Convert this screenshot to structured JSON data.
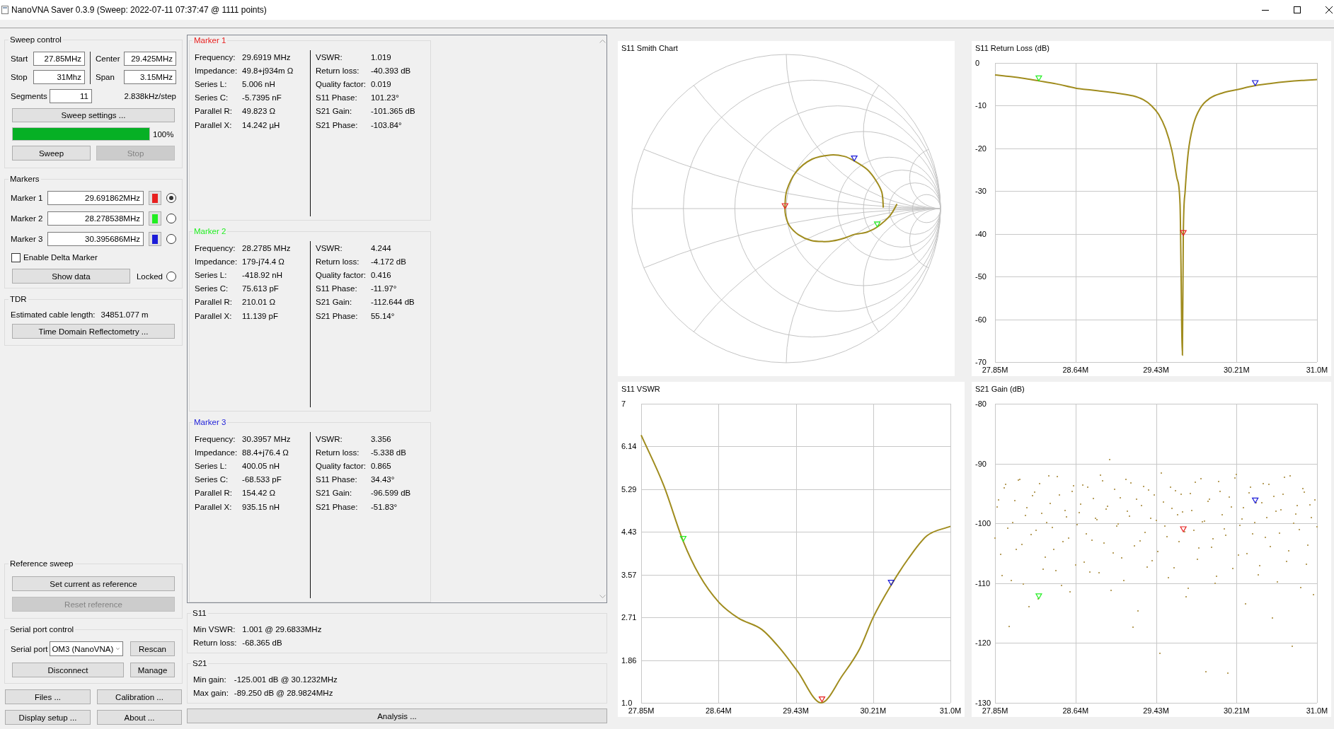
{
  "window": {
    "title": "NanoVNA Saver 0.3.9 (Sweep: 2022-07-11 07:37:47 @ 1111 points)"
  },
  "sweep_control": {
    "title": "Sweep control",
    "fields": [
      {
        "label": "Start",
        "value": "27.85MHz"
      },
      {
        "label": "Center",
        "value": "29.425MHz"
      },
      {
        "label": "Stop",
        "value": "31Mhz"
      },
      {
        "label": "Span",
        "value": "3.15MHz"
      }
    ],
    "segments": {
      "label": "Segments",
      "value": "11"
    },
    "step": "2.838kHz/step",
    "settings_button": "Sweep settings ...",
    "progress": {
      "level": 1,
      "text": "100%"
    },
    "buttons": [
      {
        "label": "Sweep",
        "disabled": false
      },
      {
        "label": "Stop",
        "disabled": true
      }
    ]
  },
  "markers": {
    "title": "Markers",
    "items": [
      {
        "label": "Marker 1",
        "value": "29.691862MHz",
        "color": "#e8201f",
        "selected": true
      },
      {
        "label": "Marker 2",
        "value": "28.278538MHz",
        "color": "#22ee22",
        "selected": false
      },
      {
        "label": "Marker 3",
        "value": "30.395686MHz",
        "color": "#1c1cd8",
        "selected": false
      }
    ],
    "delta_marker": {
      "label": "Enable Delta Marker",
      "checked": false
    },
    "show_data_button": "Show data",
    "locked": {
      "label": "Locked",
      "checked": false
    }
  },
  "tdr": {
    "title": "TDR",
    "label": "Estimated cable length:",
    "value": "34851.077 m",
    "button": "Time Domain Reflectometry ..."
  },
  "reference_sweep": {
    "title": "Reference sweep",
    "buttons": [
      {
        "label": "Set current as reference",
        "disabled": false
      },
      {
        "label": "Reset reference",
        "disabled": true
      }
    ]
  },
  "serial_port": {
    "title": "Serial port control",
    "label": "Serial port",
    "port": "OM3 (NanoVNA)",
    "rescan_button": "Rescan",
    "disconnect_button": "Disconnect",
    "manage_button": "Manage"
  },
  "bottom_buttons": [
    "Files ...",
    "Calibration ...",
    "Display setup ...",
    "About ..."
  ],
  "marker_data": [
    {
      "title": "Marker 1",
      "left": [
        {
          "label": "Frequency:",
          "value": "29.6919 MHz"
        },
        {
          "label": "Impedance:",
          "value": "49.8+j934m Ω"
        },
        {
          "label": "Series L:",
          "value": "5.006 nH"
        },
        {
          "label": "Series C:",
          "value": "-5.7395 nF"
        },
        {
          "label": "Parallel R:",
          "value": "49.823 Ω"
        },
        {
          "label": "Parallel X:",
          "value": "14.242 µH"
        }
      ],
      "right": [
        {
          "label": "VSWR:",
          "value": "1.019"
        },
        {
          "label": "Return loss:",
          "value": "-40.393 dB"
        },
        {
          "label": "Quality factor:",
          "value": "0.019"
        },
        {
          "label": "S11 Phase:",
          "value": "101.23°"
        },
        {
          "label": "S21 Gain:",
          "value": "-101.365 dB"
        },
        {
          "label": "S21 Phase:",
          "value": "-103.84°"
        }
      ]
    },
    {
      "title": "Marker 2",
      "left": [
        {
          "label": "Frequency:",
          "value": "28.2785 MHz"
        },
        {
          "label": "Impedance:",
          "value": "179-j74.4 Ω"
        },
        {
          "label": "Series L:",
          "value": "-418.92 nH"
        },
        {
          "label": "Series C:",
          "value": "75.613 pF"
        },
        {
          "label": "Parallel R:",
          "value": "210.01 Ω"
        },
        {
          "label": "Parallel X:",
          "value": "11.139 pF"
        }
      ],
      "right": [
        {
          "label": "VSWR:",
          "value": "4.244"
        },
        {
          "label": "Return loss:",
          "value": "-4.172 dB"
        },
        {
          "label": "Quality factor:",
          "value": "0.416"
        },
        {
          "label": "S11 Phase:",
          "value": "-11.97°"
        },
        {
          "label": "S21 Gain:",
          "value": "-112.644 dB"
        },
        {
          "label": "S21 Phase:",
          "value": "55.14°"
        }
      ]
    },
    {
      "title": "Marker 3",
      "left": [
        {
          "label": "Frequency:",
          "value": "30.3957 MHz"
        },
        {
          "label": "Impedance:",
          "value": "88.4+j76.4 Ω"
        },
        {
          "label": "Series L:",
          "value": "400.05 nH"
        },
        {
          "label": "Series C:",
          "value": "-68.533 pF"
        },
        {
          "label": "Parallel R:",
          "value": "154.42 Ω"
        },
        {
          "label": "Parallel X:",
          "value": "935.15 nH"
        }
      ],
      "right": [
        {
          "label": "VSWR:",
          "value": "3.356"
        },
        {
          "label": "Return loss:",
          "value": "-5.338 dB"
        },
        {
          "label": "Quality factor:",
          "value": "0.865"
        },
        {
          "label": "S11 Phase:",
          "value": "34.43°"
        },
        {
          "label": "S21 Gain:",
          "value": "-96.599 dB"
        },
        {
          "label": "S21 Phase:",
          "value": "-51.83°"
        }
      ]
    }
  ],
  "s11_summary": {
    "title": "S11",
    "rows": [
      {
        "label": "Min VSWR:",
        "value": "1.001 @ 29.6833MHz"
      },
      {
        "label": "Return loss:",
        "value": "-68.365 dB"
      }
    ]
  },
  "s21_summary": {
    "title": "S21",
    "rows": [
      {
        "label": "Min gain:",
        "value": "-125.001 dB @ 30.1232MHz"
      },
      {
        "label": "Max gain:",
        "value": "-89.250 dB @ 28.9824MHz"
      }
    ]
  },
  "analysis_button": "Analysis ...",
  "charts": [
    {
      "kind": "smith",
      "title": "S11 Smith Chart"
    },
    {
      "kind": "xy",
      "chart_data": {
        "type": "line",
        "title": "S11 Return Loss (dB)",
        "x": [
          27.85,
          28.0,
          28.15,
          28.2785,
          28.45,
          28.64,
          28.85,
          29.05,
          29.2,
          29.3,
          29.38,
          29.45,
          29.52,
          29.58,
          29.63,
          29.66,
          29.6833,
          29.6919,
          29.71,
          29.74,
          29.79,
          29.86,
          29.95,
          30.08,
          30.21,
          30.3957,
          30.55,
          30.7,
          30.85,
          31.0
        ],
        "series": [
          {
            "color": "#a08c1e",
            "values": [
              -2.8,
              -3.2,
              -3.7,
              -4.2,
              -4.9,
              -5.9,
              -6.5,
              -7.1,
              -7.7,
              -8.6,
              -10.0,
              -12.0,
              -15.5,
              -20.5,
              -27.0,
              -33.0,
              -68.4,
              -40.4,
              -30.0,
              -21.0,
              -14.5,
              -10.5,
              -8.3,
              -7.0,
              -6.3,
              -5.3,
              -4.8,
              -4.4,
              -4.1,
              -3.9
            ]
          }
        ],
        "xlim": [
          27.85,
          31.0
        ],
        "ylim": [
          -70,
          0
        ],
        "xticks": [
          {
            "value": 27.85,
            "label": "27.85M"
          },
          {
            "value": 28.6375,
            "label": "28.64M"
          },
          {
            "value": 29.425,
            "label": "29.43M"
          },
          {
            "value": 30.2125,
            "label": "30.21M"
          },
          {
            "value": 31.0,
            "label": "31.0M"
          }
        ],
        "yticks": [
          0,
          -10,
          -20,
          -30,
          -40,
          -50,
          -60,
          -70
        ],
        "grid": true
      }
    },
    {
      "kind": "xy",
      "chart_data": {
        "type": "line",
        "title": "S11 VSWR",
        "x": [
          27.85,
          28.08,
          28.2785,
          28.44,
          28.64,
          28.84,
          29.08,
          29.26,
          29.44,
          29.6833,
          29.9,
          30.08,
          30.21,
          30.3957,
          30.57,
          30.76,
          31.0
        ],
        "series": [
          {
            "color": "#a08c1e",
            "values": [
              6.37,
              5.36,
              4.24,
              3.57,
              3.02,
              2.7,
              2.47,
              2.1,
              1.64,
              1.0,
              1.55,
              2.1,
              2.7,
              3.36,
              3.89,
              4.35,
              4.54
            ]
          }
        ],
        "xlim": [
          27.85,
          31.0
        ],
        "ylim": [
          1,
          7
        ],
        "xticks": [
          {
            "value": 27.85,
            "label": "27.85M"
          },
          {
            "value": 28.6375,
            "label": "28.64M"
          },
          {
            "value": 29.425,
            "label": "29.43M"
          },
          {
            "value": 30.2125,
            "label": "30.21M"
          },
          {
            "value": 31.0,
            "label": "31.0M"
          }
        ],
        "yticks": [
          7,
          {
            "value": 6.143,
            "label": "6.14"
          },
          {
            "value": 5.286,
            "label": "5.29"
          },
          {
            "value": 4.429,
            "label": "4.43"
          },
          {
            "value": 3.571,
            "label": "3.57"
          },
          {
            "value": 2.714,
            "label": "2.71"
          },
          {
            "value": 1.857,
            "label": "1.86"
          },
          {
            "value": 1,
            "label": "1.0"
          }
        ],
        "grid": true
      }
    },
    {
      "kind": "xy",
      "chart_data": {
        "type": "scatter",
        "title": "S21 Gain (dB)",
        "x": [
          27.85,
          27.8675,
          27.885,
          27.9025,
          27.92,
          27.9375,
          27.955,
          27.9725,
          27.99,
          28.0075,
          28.025,
          28.0425,
          28.06,
          28.0775,
          28.095,
          28.1125,
          28.13,
          28.1475,
          28.165,
          28.1825,
          28.2,
          28.2175,
          28.235,
          28.2525,
          28.27,
          28.2875,
          28.305,
          28.3225,
          28.34,
          28.3575,
          28.375,
          28.3925,
          28.41,
          28.4275,
          28.445,
          28.4625,
          28.48,
          28.4975,
          28.515,
          28.5325,
          28.55,
          28.5675,
          28.585,
          28.6025,
          28.62,
          28.6375,
          28.655,
          28.6725,
          28.69,
          28.7075,
          28.725,
          28.7425,
          28.76,
          28.7775,
          28.795,
          28.8125,
          28.83,
          28.8475,
          28.865,
          28.8825,
          28.9,
          28.9175,
          28.935,
          28.9525,
          28.97,
          28.9875,
          29.005,
          29.0225,
          29.04,
          29.0575,
          29.075,
          29.0925,
          29.11,
          29.1275,
          29.145,
          29.1625,
          29.18,
          29.1975,
          29.215,
          29.2325,
          29.25,
          29.2675,
          29.285,
          29.3025,
          29.32,
          29.3375,
          29.355,
          29.3725,
          29.39,
          29.4075,
          29.425,
          29.4425,
          29.46,
          29.4775,
          29.495,
          29.5125,
          29.53,
          29.5475,
          29.565,
          29.5825,
          29.6,
          29.6175,
          29.635,
          29.6525,
          29.67,
          29.6875,
          29.705,
          29.7225,
          29.74,
          29.7575,
          29.775,
          29.7925,
          29.81,
          29.8275,
          29.845,
          29.8625,
          29.88,
          29.8975,
          29.915,
          29.9325,
          29.95,
          29.9675,
          29.985,
          30.0025,
          30.02,
          30.0375,
          30.055,
          30.0725,
          30.09,
          30.1075,
          30.125,
          30.1425,
          30.16,
          30.1775,
          30.195,
          30.2125,
          30.23,
          30.2475,
          30.265,
          30.2825,
          30.3,
          30.3175,
          30.335,
          30.3525,
          30.37,
          30.3875,
          30.405,
          30.4225,
          30.44,
          30.4575,
          30.475,
          30.4925,
          30.51,
          30.5275,
          30.545,
          30.5625,
          30.58,
          30.5975,
          30.615,
          30.6325,
          30.65,
          30.6675,
          30.685,
          30.7025,
          30.72,
          30.7375,
          30.755,
          30.7725,
          30.79,
          30.8075,
          30.825,
          30.8425,
          30.86,
          30.8775,
          30.895,
          30.9125,
          30.93,
          30.9475,
          30.965,
          30.9825,
          31.0
        ],
        "series": [
          {
            "color": "#b8a060",
            "values": [
              -102.4,
              -97.3,
              -96.1,
              -105.2,
              -108.7,
              -94.1,
              -93.5,
              -100.8,
              -117.2,
              -109.6,
              -99.8,
              -96.2,
              -104.3,
              -92.8,
              -92.6,
              -103.5,
              -110.1,
              -98.7,
              -97.4,
              -113.9,
              -101.9,
              -95.4,
              -94.8,
              -101.2,
              -112.6,
              -93.3,
              -98.3,
              -107.7,
              -105.6,
              -99.9,
              -92.1,
              -96.7,
              -100.7,
              -104.4,
              -107.9,
              -92.2,
              -95.2,
              -110.4,
              -103.1,
              -97.8,
              -98.9,
              -102.5,
              -111.4,
              -94.7,
              -93.7,
              -106.9,
              -100.2,
              -98.2,
              -96.8,
              -93.6,
              -106.5,
              -101.7,
              -94.0,
              -108.1,
              -102.8,
              -95.8,
              -99.1,
              -99.4,
              -108.3,
              -91.9,
              -92.9,
              -103.3,
              -97.6,
              -97.1,
              -89.3,
              -111.2,
              -104.9,
              -94.3,
              -100.4,
              -100.1,
              -95.7,
              -105.8,
              -109.5,
              -92.7,
              -98.0,
              -98.8,
              -93.2,
              -117.3,
              -103.7,
              -96.0,
              -114.6,
              -102.9,
              -97.0,
              -93.8,
              -101.5,
              -107.3,
              -94.4,
              -99.2,
              -106.2,
              -95.3,
              -99.5,
              -104.7,
              -121.7,
              -91.6,
              -96.4,
              -100.5,
              -102.2,
              -109.1,
              -93.9,
              -97.5,
              -107.4,
              -94.5,
              -98.6,
              -103.0,
              -95.1,
              -98.1,
              -101.4,
              -112.3,
              -110.8,
              -95.0,
              -97.9,
              -101.1,
              -93.1,
              -106.0,
              -104.1,
              -92.5,
              -99.7,
              -99.6,
              -124.8,
              -96.3,
              -95.9,
              -104.0,
              -102.6,
              -110.0,
              -108.9,
              -93.0,
              -94.6,
              -98.5,
              -100.9,
              -102.0,
              -125.0,
              -95.6,
              -97.2,
              -107.6,
              -92.4,
              -91.8,
              -105.3,
              -100.3,
              -99.3,
              -97.4,
              -113.5,
              -105.0,
              -94.9,
              -94.0,
              -101.8,
              -99.8,
              -96.6,
              -108.6,
              -107.1,
              -96.5,
              -93.4,
              -102.3,
              -99.0,
              -93.5,
              -103.9,
              -115.8,
              -95.5,
              -98.0,
              -109.8,
              -101.6,
              -97.7,
              -95.1,
              -92.3,
              -106.4,
              -104.6,
              -92.0,
              -120.5,
              -100.0,
              -98.4,
              -97.0,
              -101.0,
              -110.7,
              -94.2,
              -94.8,
              -106.8,
              -103.6,
              -96.9,
              -99.0,
              -111.9,
              -96.1,
              -100.6
            ]
          }
        ],
        "xlim": [
          27.85,
          31.0
        ],
        "ylim": [
          -130,
          -80
        ],
        "xticks": [
          {
            "value": 27.85,
            "label": "27.85M"
          },
          {
            "value": 28.6375,
            "label": "28.64M"
          },
          {
            "value": 29.425,
            "label": "29.43M"
          },
          {
            "value": 30.2125,
            "label": "30.21M"
          },
          {
            "value": 31.0,
            "label": "31.0M"
          }
        ],
        "yticks": [
          -80,
          -90,
          -100,
          -110,
          -120,
          -130
        ],
        "grid": true
      }
    }
  ]
}
